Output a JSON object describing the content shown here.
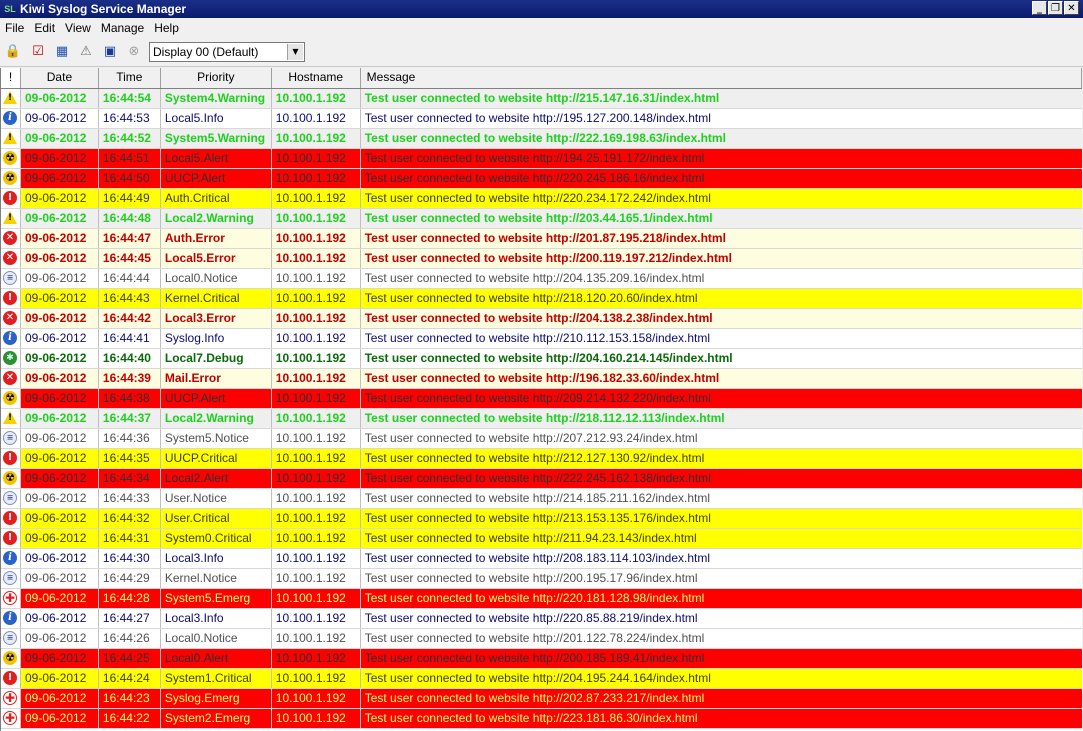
{
  "window": {
    "title": "Kiwi Syslog Service Manager",
    "app_icon": "kiwi-icon",
    "controls": [
      "_",
      "❐",
      "✕"
    ]
  },
  "menu": [
    "File",
    "Edit",
    "View",
    "Manage",
    "Help"
  ],
  "toolbar": {
    "display_value": "Display 00 (Default)"
  },
  "table": {
    "headers": [
      "!",
      "Date",
      "Time",
      "Priority",
      "Hostname",
      "Message"
    ],
    "rows": [
      {
        "level": "warning",
        "date": "09-06-2012",
        "time": "16:44:54",
        "priority": "System4.Warning",
        "host": "10.100.1.192",
        "msg": "Test user connected to website http://215.147.16.31/index.html"
      },
      {
        "level": "info",
        "date": "09-06-2012",
        "time": "16:44:53",
        "priority": "Local5.Info",
        "host": "10.100.1.192",
        "msg": "Test user connected to website http://195.127.200.148/index.html"
      },
      {
        "level": "warning",
        "date": "09-06-2012",
        "time": "16:44:52",
        "priority": "System5.Warning",
        "host": "10.100.1.192",
        "msg": "Test user connected to website http://222.169.198.63/index.html"
      },
      {
        "level": "alert",
        "date": "09-06-2012",
        "time": "16:44:51",
        "priority": "Local5.Alert",
        "host": "10.100.1.192",
        "msg": "Test user connected to website http://194.25.191.172/index.html"
      },
      {
        "level": "alert",
        "date": "09-06-2012",
        "time": "16:44:50",
        "priority": "UUCP.Alert",
        "host": "10.100.1.192",
        "msg": "Test user connected to website http://220.245.186.16/index.html"
      },
      {
        "level": "critical",
        "date": "09-06-2012",
        "time": "16:44:49",
        "priority": "Auth.Critical",
        "host": "10.100.1.192",
        "msg": "Test user connected to website http://220.234.172.242/index.html"
      },
      {
        "level": "warning",
        "date": "09-06-2012",
        "time": "16:44:48",
        "priority": "Local2.Warning",
        "host": "10.100.1.192",
        "msg": "Test user connected to website http://203.44.165.1/index.html"
      },
      {
        "level": "error",
        "date": "09-06-2012",
        "time": "16:44:47",
        "priority": "Auth.Error",
        "host": "10.100.1.192",
        "msg": "Test user connected to website http://201.87.195.218/index.html"
      },
      {
        "level": "error",
        "date": "09-06-2012",
        "time": "16:44:45",
        "priority": "Local5.Error",
        "host": "10.100.1.192",
        "msg": "Test user connected to website http://200.119.197.212/index.html"
      },
      {
        "level": "notice",
        "date": "09-06-2012",
        "time": "16:44:44",
        "priority": "Local0.Notice",
        "host": "10.100.1.192",
        "msg": "Test user connected to website http://204.135.209.16/index.html"
      },
      {
        "level": "critical",
        "date": "09-06-2012",
        "time": "16:44:43",
        "priority": "Kernel.Critical",
        "host": "10.100.1.192",
        "msg": "Test user connected to website http://218.120.20.60/index.html"
      },
      {
        "level": "error",
        "date": "09-06-2012",
        "time": "16:44:42",
        "priority": "Local3.Error",
        "host": "10.100.1.192",
        "msg": "Test user connected to website http://204.138.2.38/index.html"
      },
      {
        "level": "info",
        "date": "09-06-2012",
        "time": "16:44:41",
        "priority": "Syslog.Info",
        "host": "10.100.1.192",
        "msg": "Test user connected to website http://210.112.153.158/index.html"
      },
      {
        "level": "debug",
        "date": "09-06-2012",
        "time": "16:44:40",
        "priority": "Local7.Debug",
        "host": "10.100.1.192",
        "msg": "Test user connected to website http://204.160.214.145/index.html"
      },
      {
        "level": "error",
        "date": "09-06-2012",
        "time": "16:44:39",
        "priority": "Mail.Error",
        "host": "10.100.1.192",
        "msg": "Test user connected to website http://196.182.33.60/index.html"
      },
      {
        "level": "alert",
        "date": "09-06-2012",
        "time": "16:44:38",
        "priority": "UUCP.Alert",
        "host": "10.100.1.192",
        "msg": "Test user connected to website http://209.214.132.220/index.html"
      },
      {
        "level": "warning",
        "date": "09-06-2012",
        "time": "16:44:37",
        "priority": "Local2.Warning",
        "host": "10.100.1.192",
        "msg": "Test user connected to website http://218.112.12.113/index.html"
      },
      {
        "level": "notice",
        "date": "09-06-2012",
        "time": "16:44:36",
        "priority": "System5.Notice",
        "host": "10.100.1.192",
        "msg": "Test user connected to website http://207.212.93.24/index.html"
      },
      {
        "level": "critical",
        "date": "09-06-2012",
        "time": "16:44:35",
        "priority": "UUCP.Critical",
        "host": "10.100.1.192",
        "msg": "Test user connected to website http://212.127.130.92/index.html"
      },
      {
        "level": "alert",
        "date": "09-06-2012",
        "time": "16:44:34",
        "priority": "Local2.Alert",
        "host": "10.100.1.192",
        "msg": "Test user connected to website http://222.245.162.138/index.html"
      },
      {
        "level": "notice",
        "date": "09-06-2012",
        "time": "16:44:33",
        "priority": "User.Notice",
        "host": "10.100.1.192",
        "msg": "Test user connected to website http://214.185.211.162/index.html"
      },
      {
        "level": "critical",
        "date": "09-06-2012",
        "time": "16:44:32",
        "priority": "User.Critical",
        "host": "10.100.1.192",
        "msg": "Test user connected to website http://213.153.135.176/index.html"
      },
      {
        "level": "critical",
        "date": "09-06-2012",
        "time": "16:44:31",
        "priority": "System0.Critical",
        "host": "10.100.1.192",
        "msg": "Test user connected to website http://211.94.23.143/index.html"
      },
      {
        "level": "info",
        "date": "09-06-2012",
        "time": "16:44:30",
        "priority": "Local3.Info",
        "host": "10.100.1.192",
        "msg": "Test user connected to website http://208.183.114.103/index.html"
      },
      {
        "level": "notice",
        "date": "09-06-2012",
        "time": "16:44:29",
        "priority": "Kernel.Notice",
        "host": "10.100.1.192",
        "msg": "Test user connected to website http://200.195.17.96/index.html"
      },
      {
        "level": "emerg",
        "date": "09-06-2012",
        "time": "16:44:28",
        "priority": "System5.Emerg",
        "host": "10.100.1.192",
        "msg": "Test user connected to website http://220.181.128.98/index.html"
      },
      {
        "level": "info",
        "date": "09-06-2012",
        "time": "16:44:27",
        "priority": "Local3.Info",
        "host": "10.100.1.192",
        "msg": "Test user connected to website http://220.85.88.219/index.html"
      },
      {
        "level": "notice",
        "date": "09-06-2012",
        "time": "16:44:26",
        "priority": "Local0.Notice",
        "host": "10.100.1.192",
        "msg": "Test user connected to website http://201.122.78.224/index.html"
      },
      {
        "level": "alert",
        "date": "09-06-2012",
        "time": "16:44:25",
        "priority": "Local0.Alert",
        "host": "10.100.1.192",
        "msg": "Test user connected to website http://200.185.189.41/index.html"
      },
      {
        "level": "critical",
        "date": "09-06-2012",
        "time": "16:44:24",
        "priority": "System1.Critical",
        "host": "10.100.1.192",
        "msg": "Test user connected to website http://204.195.244.164/index.html"
      },
      {
        "level": "emerg",
        "date": "09-06-2012",
        "time": "16:44:23",
        "priority": "Syslog.Emerg",
        "host": "10.100.1.192",
        "msg": "Test user connected to website http://202.87.233.217/index.html"
      },
      {
        "level": "emerg",
        "date": "09-06-2012",
        "time": "16:44:22",
        "priority": "System2.Emerg",
        "host": "10.100.1.192",
        "msg": "Test user connected to website http://223.181.86.30/index.html"
      }
    ]
  }
}
